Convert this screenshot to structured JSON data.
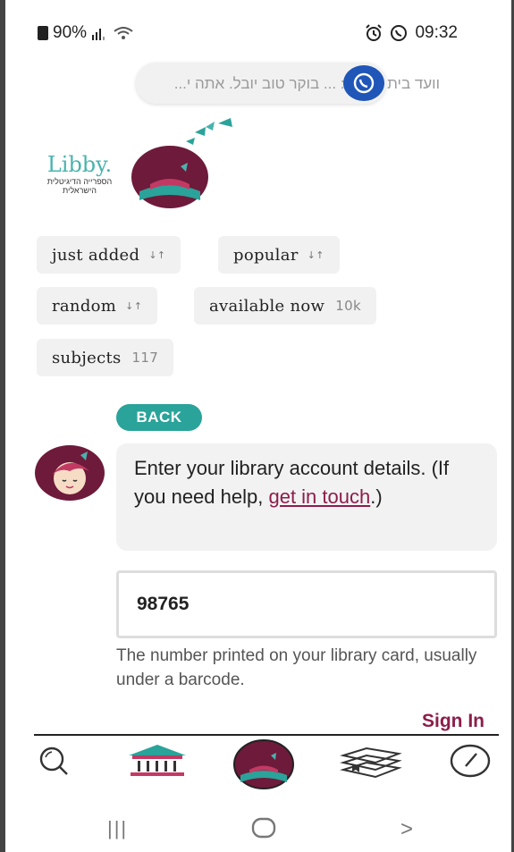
{
  "status_bar": {
    "battery": "90%",
    "time": "09:32"
  },
  "notification": {
    "text": "וועד בית צדק 6: ... בוקר טוב יובל. אתה י..."
  },
  "logo": {
    "name": "Libby.",
    "subtitle": "הספרייה הדיגיטלית הישראלית"
  },
  "chips": [
    {
      "label": "just added",
      "sort": "↓↑",
      "count": ""
    },
    {
      "label": "popular",
      "sort": "↓↑",
      "count": ""
    },
    {
      "label": "random",
      "sort": "↓↑",
      "count": ""
    },
    {
      "label": "available now",
      "sort": "",
      "count": "10k"
    },
    {
      "label": "subjects",
      "sort": "",
      "count": "117"
    }
  ],
  "back_button": "BACK",
  "message": {
    "text_before": "Enter your library account details. (If you need help, ",
    "link": "get in touch",
    "text_after": ".)"
  },
  "card_input": {
    "value": "98765"
  },
  "hint": "The number printed on your library card, usually under a barcode.",
  "sign_in": "Sign In",
  "nav": {
    "icons": [
      "search-icon",
      "library-icon",
      "libby-home-icon",
      "shelf-books-icon",
      "timeline-clock-icon"
    ]
  },
  "system_nav": {
    "recents": "|||",
    "home": "○",
    "back": ">"
  },
  "colors": {
    "accent_teal": "#2aa39a",
    "brand_maroon": "#8c1d4a",
    "whatsapp_blue": "#1f56b8"
  }
}
